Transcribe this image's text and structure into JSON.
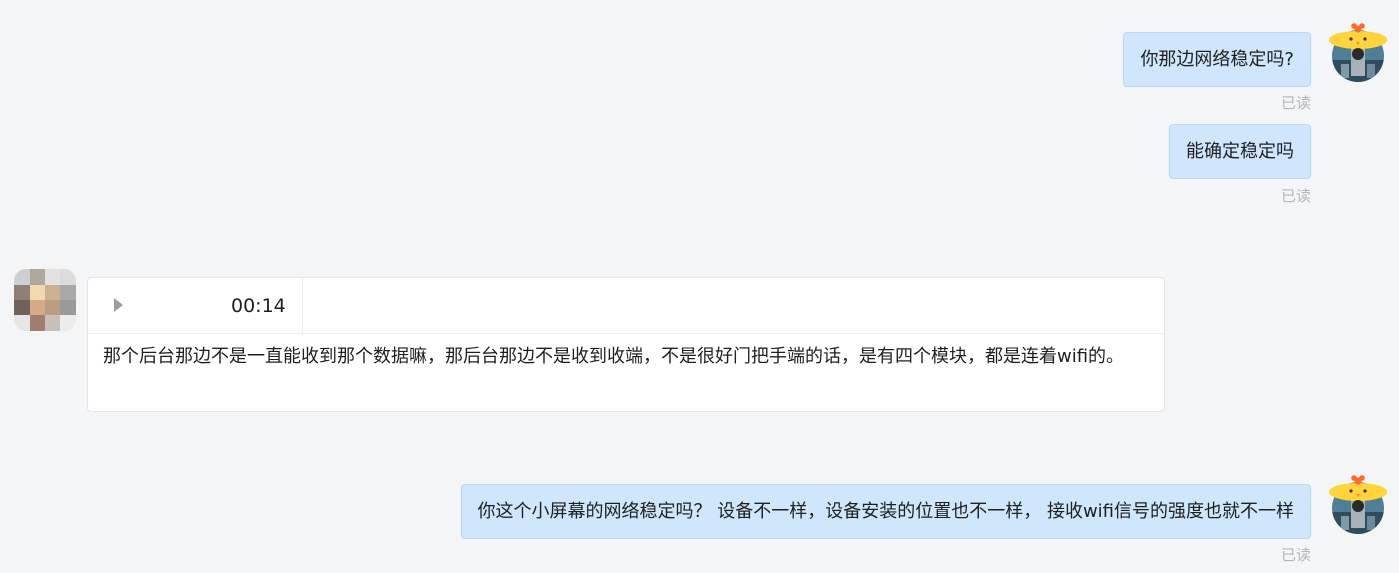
{
  "messages": {
    "m1": {
      "text": "你那边网络稳定吗?",
      "status": "已读"
    },
    "m2": {
      "text": "能确定稳定吗",
      "status": "已读"
    },
    "voice": {
      "duration": "00:14",
      "transcript": "那个后台那边不是一直能收到那个数据嘛，那后台那边不是收到收端，不是很好门把手端的话，是有四个模块，都是连着wifi的。"
    },
    "m3": {
      "text": "你这个小屏幕的网络稳定吗？  设备不一样，设备安装的位置也不一样， 接收wifi信号的强度也就不一样",
      "status": "已读"
    }
  },
  "colors": {
    "background": "#f4f5f7",
    "outgoing_bubble": "#cfe6fd",
    "read_status": "#b3b6bb"
  },
  "icons": {
    "play": "play-icon",
    "avatar_me": "cartoon-chicken-avatar",
    "avatar_other": "pixelated-avatar"
  }
}
